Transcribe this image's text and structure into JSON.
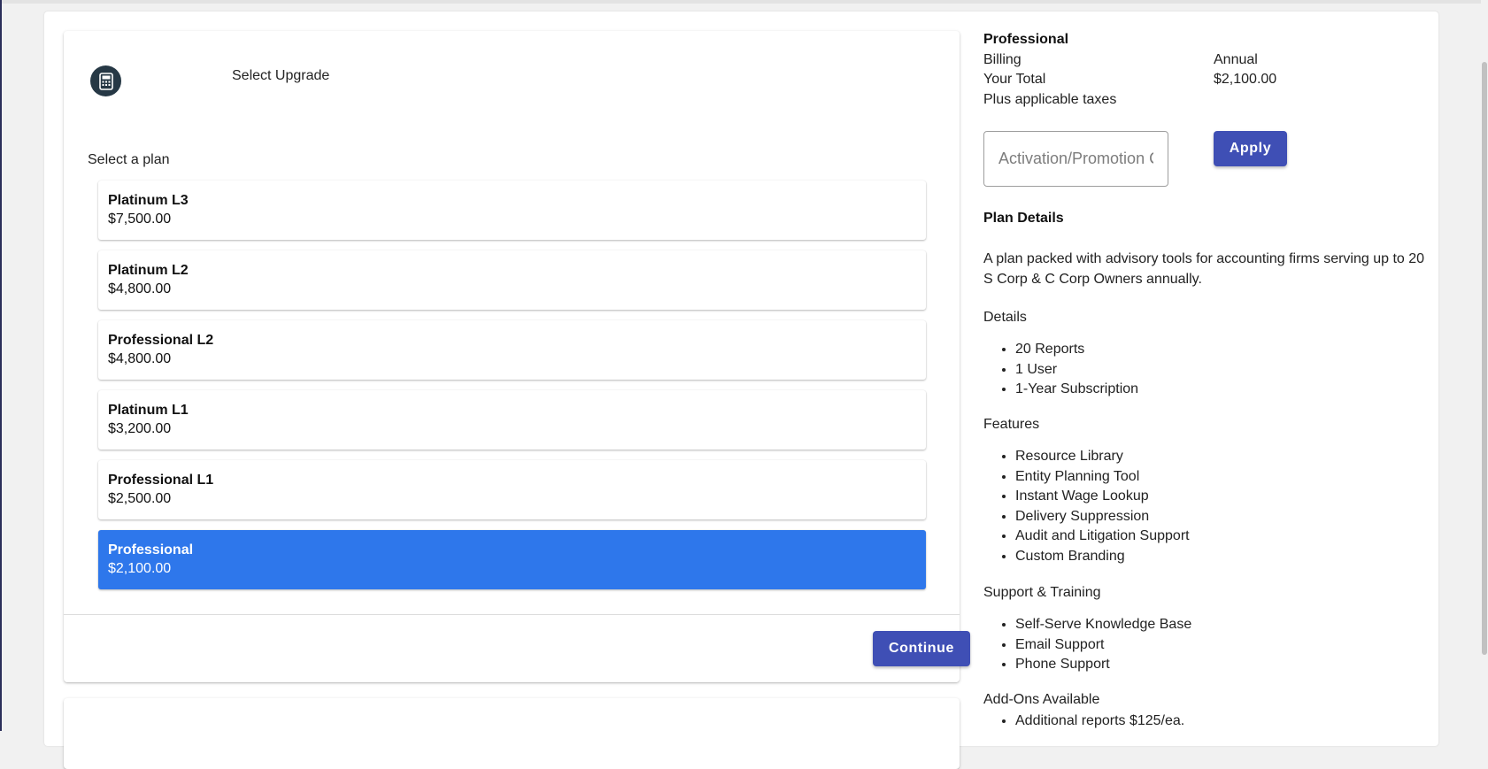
{
  "plan_selector": {
    "step_title": "Select Upgrade",
    "step_icon": "calculator-icon",
    "select_label": "Select a plan",
    "plans": [
      {
        "name": "Platinum L3",
        "price": "$7,500.00"
      },
      {
        "name": "Platinum L2",
        "price": "$4,800.00"
      },
      {
        "name": "Professional L2",
        "price": "$4,800.00"
      },
      {
        "name": "Platinum L1",
        "price": "$3,200.00"
      },
      {
        "name": "Professional L1",
        "price": "$2,500.00"
      },
      {
        "name": "Professional",
        "price": "$2,100.00"
      }
    ],
    "selected_plan": "Professional",
    "continue_label": "Continue"
  },
  "summary": {
    "plan_name": "Professional",
    "billing_label": "Billing",
    "billing_value": "Annual",
    "total_label": "Your Total",
    "total_value": "$2,100.00",
    "tax_note": "Plus applicable taxes",
    "promo_placeholder": "Activation/Promotion Code",
    "apply_label": "Apply"
  },
  "plan_details": {
    "heading": "Plan Details",
    "description": "A plan packed with advisory tools for accounting firms serving up to 20 S Corp & C Corp Owners annually.",
    "details_heading": "Details",
    "details": [
      "20 Reports",
      "1 User",
      "1-Year Subscription"
    ],
    "features_heading": "Features",
    "features": [
      "Resource Library",
      "Entity Planning Tool",
      "Instant Wage Lookup",
      "Delivery Suppression",
      "Audit and Litigation Support",
      "Custom Branding"
    ],
    "support_heading": "Support & Training",
    "support": [
      "Self-Serve Knowledge Base",
      "Email Support",
      "Phone Support"
    ],
    "addons_heading": "Add-Ons Available",
    "addons": [
      "Additional reports $125/ea."
    ]
  },
  "colors": {
    "selected_plan": "#2e77eb",
    "button": "#3f4fb5",
    "step_icon_bg": "#263845"
  }
}
